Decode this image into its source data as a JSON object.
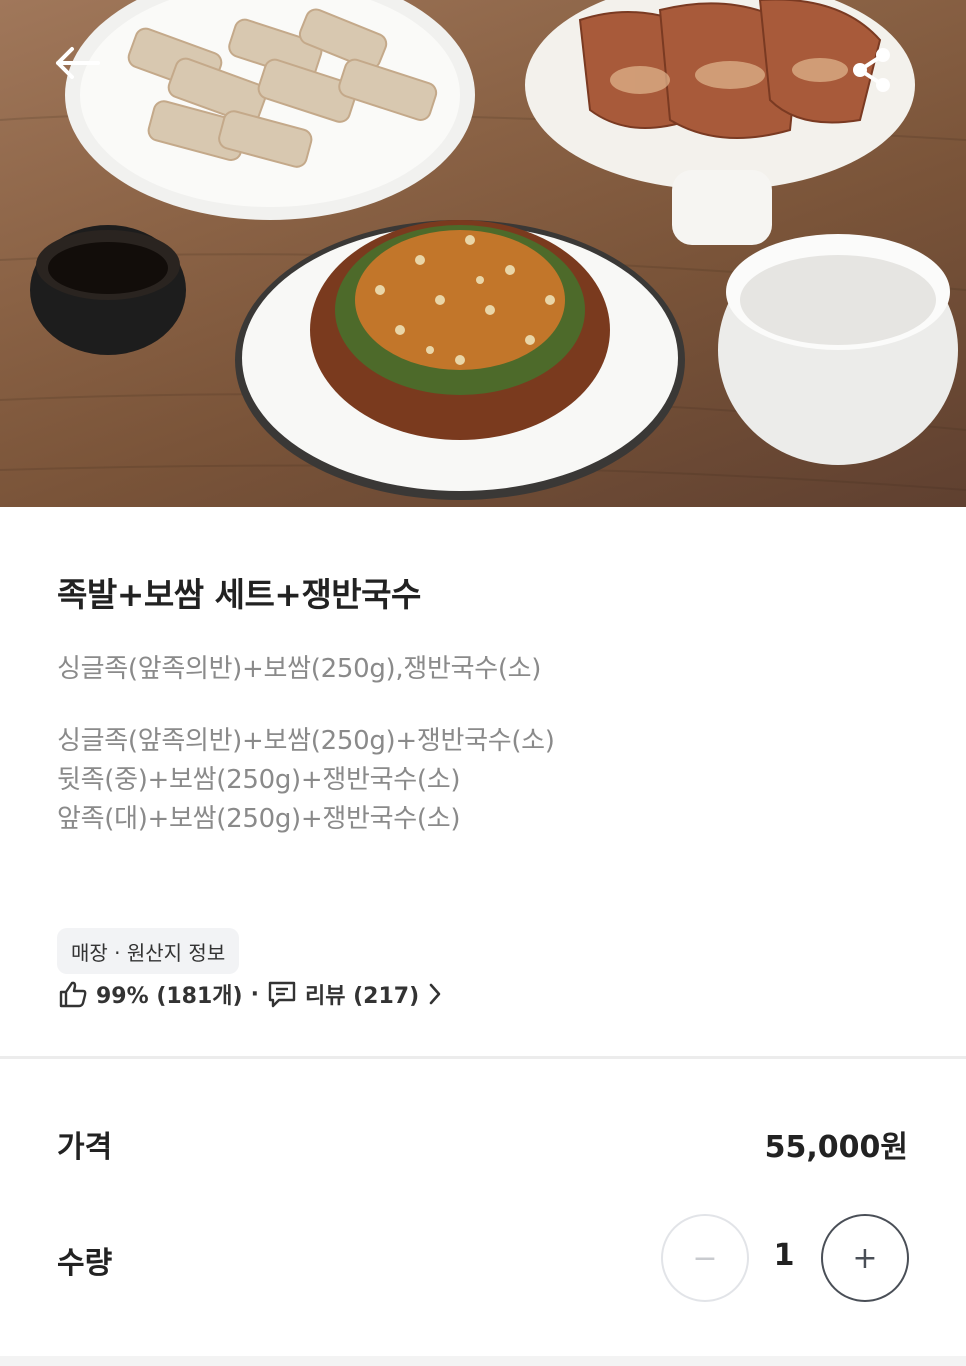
{
  "product": {
    "title": "족발+보쌈 세트+쟁반국수",
    "description": "싱글족(앞족의반)+보쌈(250g),쟁반국수(소)",
    "options": [
      "싱글족(앞족의반)+보쌈(250g)+쟁반국수(소)",
      "뒷족(중)+보쌈(250g)+쟁반국수(소)",
      "앞족(대)+보쌈(250g)+쟁반국수(소)"
    ]
  },
  "store_info_chip": "매장 · 원산지 정보",
  "stats": {
    "like_text": "99% (181개)",
    "separator": "·",
    "review_text": "리뷰 (217)"
  },
  "price": {
    "label": "가격",
    "value": "55,000원"
  },
  "quantity": {
    "label": "수량",
    "value": "1",
    "minus_symbol": "−",
    "plus_symbol": "+"
  },
  "icons": {
    "back": "arrow-left-icon",
    "share": "share-icon",
    "like": "thumbs-up-icon",
    "review": "comment-icon",
    "more": "chevron-right-icon"
  },
  "colors": {
    "muted_text": "#8a8a8a",
    "chip_bg": "#f2f3f5",
    "plus_border": "#4a4f57",
    "minus_border": "#e2e4e8"
  }
}
